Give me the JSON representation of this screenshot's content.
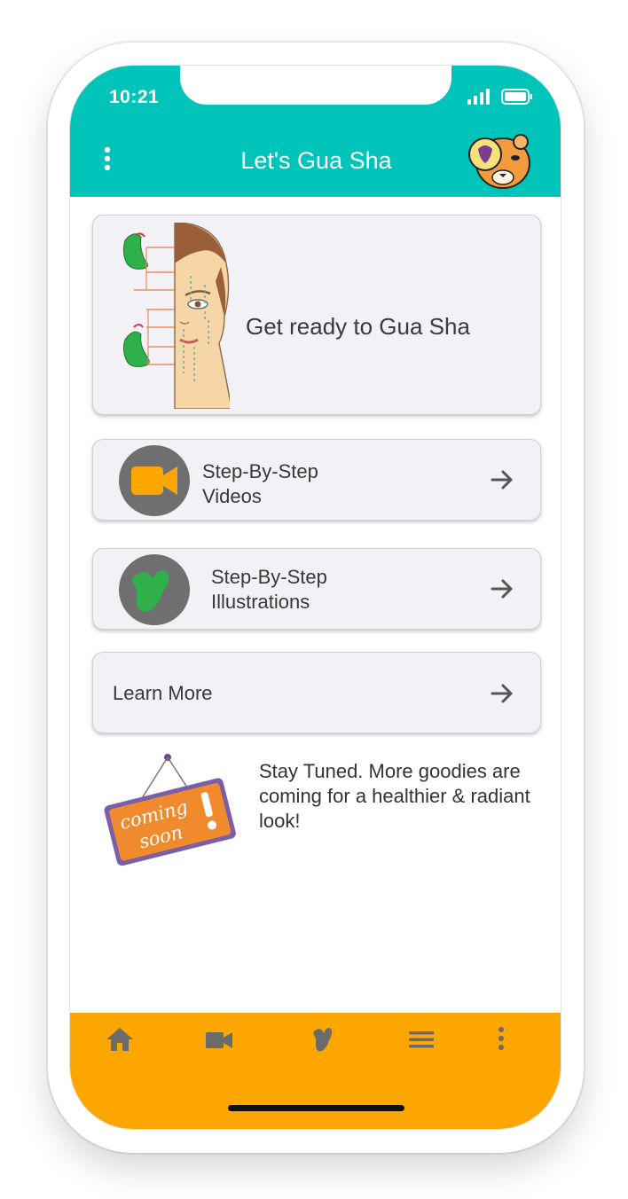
{
  "status_bar": {
    "time": "10:21"
  },
  "header": {
    "title": "Let's Gua Sha"
  },
  "hero_card": {
    "text": "Get ready to Gua Sha"
  },
  "menu": [
    {
      "line1": "Step-By-Step",
      "line2": "Videos"
    },
    {
      "line1": "Step-By-Step",
      "line2": "Illustrations"
    },
    {
      "label": "Learn More"
    }
  ],
  "coming_soon": {
    "sign_text_1": "coming",
    "sign_text_2": "soon",
    "message": "Stay Tuned. More goodies are coming for a healthier & radiant look!"
  },
  "bottom_nav": {
    "items": [
      "home-icon",
      "video-camera-icon",
      "gua-sha-stone-icon",
      "list-icon",
      "more-dots-icon"
    ]
  },
  "colors": {
    "header": "#00c3b9",
    "bottom_nav": "#fea600",
    "video_icon": "#fea600",
    "stone_green": "#2fb04a",
    "card_bg": "#f2f1f5"
  }
}
